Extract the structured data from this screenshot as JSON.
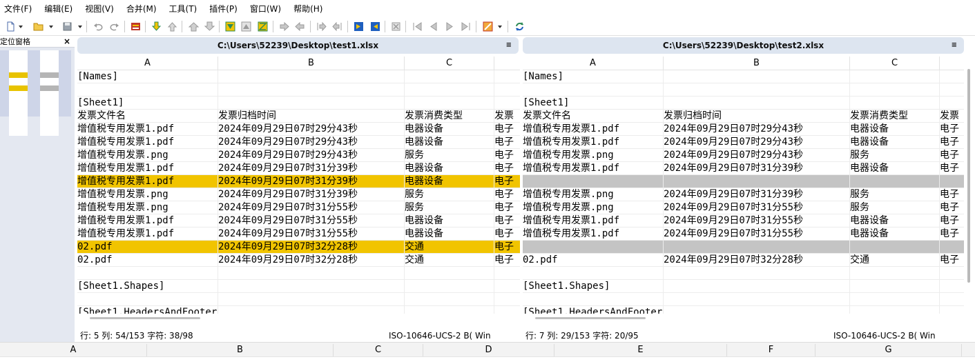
{
  "menu": [
    {
      "label": "文件(F)",
      "name": "file"
    },
    {
      "label": "编辑(E)",
      "name": "edit"
    },
    {
      "label": "视图(V)",
      "name": "view"
    },
    {
      "label": "合并(M)",
      "name": "merge"
    },
    {
      "label": "工具(T)",
      "name": "tools"
    },
    {
      "label": "插件(P)",
      "name": "plugins"
    },
    {
      "label": "窗口(W)",
      "name": "window"
    },
    {
      "label": "帮助(H)",
      "name": "help"
    }
  ],
  "locator": {
    "title": "定位窗格",
    "close": "×",
    "marker_color_diff": "#e8c300",
    "marker_color_gap": "#b5b5b5"
  },
  "colors": {
    "highlight_yellow": "#f1c400",
    "highlight_gray": "#c4c4c4",
    "panel_title_bg": "#dde5f0"
  },
  "left": {
    "title": "C:\\Users\\52239\\Desktop\\test1.xlsx",
    "menu_icon": "≡",
    "columns": [
      "A",
      "B",
      "C"
    ],
    "rows": [
      {
        "a": "[Names]",
        "b": "",
        "c": "",
        "d": "",
        "hl": ""
      },
      {
        "a": "",
        "b": "",
        "c": "",
        "d": "",
        "hl": ""
      },
      {
        "a": "[Sheet1]",
        "b": "",
        "c": "",
        "d": "",
        "hl": ""
      },
      {
        "a": "发票文件名",
        "b": "发票归档时间",
        "c": "发票消费类型",
        "d": "发票",
        "hl": ""
      },
      {
        "a": "增值税专用发票1.pdf",
        "b": "2024年09月29日07时29分43秒",
        "c": "电器设备",
        "d": "电子",
        "hl": ""
      },
      {
        "a": "增值税专用发票1.pdf",
        "b": "2024年09月29日07时29分43秒",
        "c": "电器设备",
        "d": "电子",
        "hl": ""
      },
      {
        "a": "增值税专用发票.png",
        "b": "2024年09月29日07时29分43秒",
        "c": "服务",
        "d": "电子",
        "hl": ""
      },
      {
        "a": "增值税专用发票1.pdf",
        "b": "2024年09月29日07时31分39秒",
        "c": "电器设备",
        "d": "电子",
        "hl": ""
      },
      {
        "a": "增值税专用发票1.pdf",
        "b": "2024年09月29日07时31分39秒",
        "c": "电器设备",
        "d": "电子",
        "hl": "yellow"
      },
      {
        "a": "增值税专用发票.png",
        "b": "2024年09月29日07时31分39秒",
        "c": "服务",
        "d": "电子",
        "hl": ""
      },
      {
        "a": "增值税专用发票.png",
        "b": "2024年09月29日07时31分55秒",
        "c": "服务",
        "d": "电子",
        "hl": ""
      },
      {
        "a": "增值税专用发票1.pdf",
        "b": "2024年09月29日07时31分55秒",
        "c": "电器设备",
        "d": "电子",
        "hl": ""
      },
      {
        "a": "增值税专用发票1.pdf",
        "b": "2024年09月29日07时31分55秒",
        "c": "电器设备",
        "d": "电子",
        "hl": ""
      },
      {
        "a": "02.pdf",
        "b": "2024年09月29日07时32分28秒",
        "c": "交通",
        "d": "电子",
        "hl": "yellow"
      },
      {
        "a": "02.pdf",
        "b": "2024年09月29日07时32分28秒",
        "c": "交通",
        "d": "电子",
        "hl": ""
      },
      {
        "a": "",
        "b": "",
        "c": "",
        "d": "",
        "hl": ""
      },
      {
        "a": "[Sheet1.Shapes]",
        "b": "",
        "c": "",
        "d": "",
        "hl": ""
      },
      {
        "a": "",
        "b": "",
        "c": "",
        "d": "",
        "hl": ""
      },
      {
        "a": "[Sheet1.HeadersAndFooters]",
        "b": "",
        "c": "",
        "d": "",
        "hl": ""
      }
    ],
    "status": {
      "position": "行: 5  列: 54/153  字符: 38/98",
      "encoding": "ISO-10646-UCS-2 B(  Win"
    }
  },
  "right": {
    "title": "C:\\Users\\52239\\Desktop\\test2.xlsx",
    "menu_icon": "≡",
    "columns": [
      "A",
      "B",
      "C"
    ],
    "rows": [
      {
        "a": "[Names]",
        "b": "",
        "c": "",
        "d": "",
        "hl": ""
      },
      {
        "a": "",
        "b": "",
        "c": "",
        "d": "",
        "hl": ""
      },
      {
        "a": "[Sheet1]",
        "b": "",
        "c": "",
        "d": "",
        "hl": ""
      },
      {
        "a": "发票文件名",
        "b": "发票归档时间",
        "c": "发票消费类型",
        "d": "发票",
        "hl": ""
      },
      {
        "a": "增值税专用发票1.pdf",
        "b": "2024年09月29日07时29分43秒",
        "c": "电器设备",
        "d": "电子",
        "hl": ""
      },
      {
        "a": "增值税专用发票1.pdf",
        "b": "2024年09月29日07时29分43秒",
        "c": "电器设备",
        "d": "电子",
        "hl": ""
      },
      {
        "a": "增值税专用发票.png",
        "b": "2024年09月29日07时29分43秒",
        "c": "服务",
        "d": "电子",
        "hl": ""
      },
      {
        "a": "增值税专用发票1.pdf",
        "b": "2024年09月29日07时31分39秒",
        "c": "电器设备",
        "d": "电子",
        "hl": ""
      },
      {
        "a": "",
        "b": "",
        "c": "",
        "d": "",
        "hl": "gray"
      },
      {
        "a": "增值税专用发票.png",
        "b": "2024年09月29日07时31分39秒",
        "c": "服务",
        "d": "电子",
        "hl": ""
      },
      {
        "a": "增值税专用发票.png",
        "b": "2024年09月29日07时31分55秒",
        "c": "服务",
        "d": "电子",
        "hl": ""
      },
      {
        "a": "增值税专用发票1.pdf",
        "b": "2024年09月29日07时31分55秒",
        "c": "电器设备",
        "d": "电子",
        "hl": ""
      },
      {
        "a": "增值税专用发票1.pdf",
        "b": "2024年09月29日07时31分55秒",
        "c": "电器设备",
        "d": "电子",
        "hl": ""
      },
      {
        "a": "",
        "b": "",
        "c": "",
        "d": "",
        "hl": "gray"
      },
      {
        "a": "02.pdf",
        "b": "2024年09月29日07时32分28秒",
        "c": "交通",
        "d": "电子",
        "hl": ""
      },
      {
        "a": "",
        "b": "",
        "c": "",
        "d": "",
        "hl": ""
      },
      {
        "a": "[Sheet1.Shapes]",
        "b": "",
        "c": "",
        "d": "",
        "hl": ""
      },
      {
        "a": "",
        "b": "",
        "c": "",
        "d": "",
        "hl": ""
      },
      {
        "a": "[Sheet1.HeadersAndFooters]",
        "b": "",
        "c": "",
        "d": "",
        "hl": ""
      }
    ],
    "status": {
      "position": "行: 7  列: 29/153  字符: 20/95",
      "encoding": "ISO-10646-UCS-2 B(  Win"
    }
  },
  "bottom_columns": [
    "A",
    "B",
    "C",
    "D",
    "E",
    "F",
    "G"
  ]
}
